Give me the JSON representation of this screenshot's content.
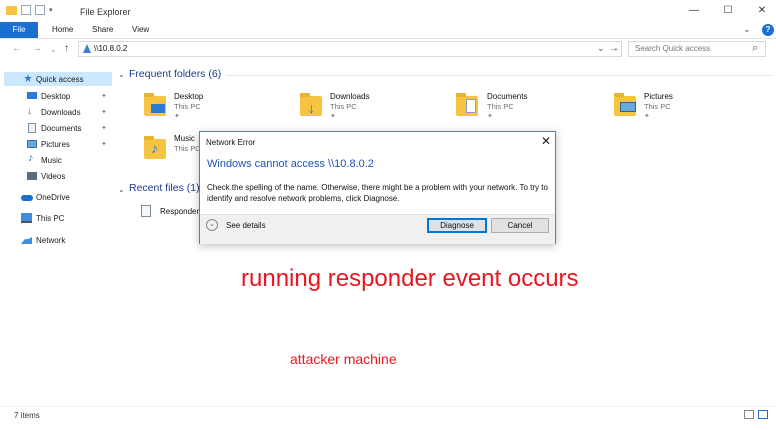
{
  "window": {
    "title": "File Explorer",
    "controls": {
      "minimize": "—",
      "maximize": "☐",
      "close": "✕"
    }
  },
  "ribbon": {
    "tabs": [
      "File",
      "Home",
      "Share",
      "View"
    ],
    "help_glyph": "?",
    "collapse_glyph": "⌄"
  },
  "nav": {
    "back_glyph": "←",
    "forward_glyph": "→",
    "recent_glyph": "⌄",
    "up_glyph": "↑",
    "address": "\\\\10.8.0.2",
    "address_dropdown_glyph": "⌄",
    "go_glyph": "→",
    "search_placeholder": "Search Quick access",
    "search_glyph": "⌕"
  },
  "sidebar": {
    "items": [
      {
        "label": "Quick access",
        "icon": "star-icon"
      },
      {
        "label": "Desktop",
        "icon": "desktop-icon",
        "pinned": true
      },
      {
        "label": "Downloads",
        "icon": "download-icon",
        "pinned": true
      },
      {
        "label": "Documents",
        "icon": "documents-icon",
        "pinned": true
      },
      {
        "label": "Pictures",
        "icon": "pictures-icon",
        "pinned": true
      },
      {
        "label": "Music",
        "icon": "music-icon"
      },
      {
        "label": "Videos",
        "icon": "videos-icon"
      },
      {
        "label": "OneDrive",
        "icon": "cloud-icon"
      },
      {
        "label": "This PC",
        "icon": "computer-icon"
      },
      {
        "label": "Network",
        "icon": "network-icon"
      }
    ],
    "pin_glyph": "📌"
  },
  "main": {
    "frequent": {
      "header": "Frequent folders (6)",
      "tiles": [
        {
          "name": "Desktop",
          "sub": "This PC"
        },
        {
          "name": "Downloads",
          "sub": "This PC"
        },
        {
          "name": "Documents",
          "sub": "This PC"
        },
        {
          "name": "Pictures",
          "sub": "This PC"
        },
        {
          "name": "Music",
          "sub": "This PC"
        }
      ]
    },
    "recent": {
      "header": "Recent files (1)",
      "items": [
        {
          "name": "Responder"
        }
      ]
    }
  },
  "dialog": {
    "title": "Network Error",
    "close_glyph": "✕",
    "heading": "Windows cannot access \\\\10.8.0.2",
    "body": "Check the spelling of the name. Otherwise, there might be a problem with your network. To try to identify and resolve network problems, click Diagnose.",
    "details_label": "See details",
    "details_glyph": "⌄",
    "diagnose_label": "Diagnose",
    "cancel_label": "Cancel"
  },
  "annotations": {
    "headline": "running responder event occurs",
    "caption": "attacker machine",
    "color": "#e8161e"
  },
  "status": {
    "items_count": "7 items"
  },
  "colors": {
    "accent": "#1a6fd1",
    "selection": "#cce8ff",
    "folder": "#f5c542",
    "dialog_heading": "#1b55b5"
  }
}
